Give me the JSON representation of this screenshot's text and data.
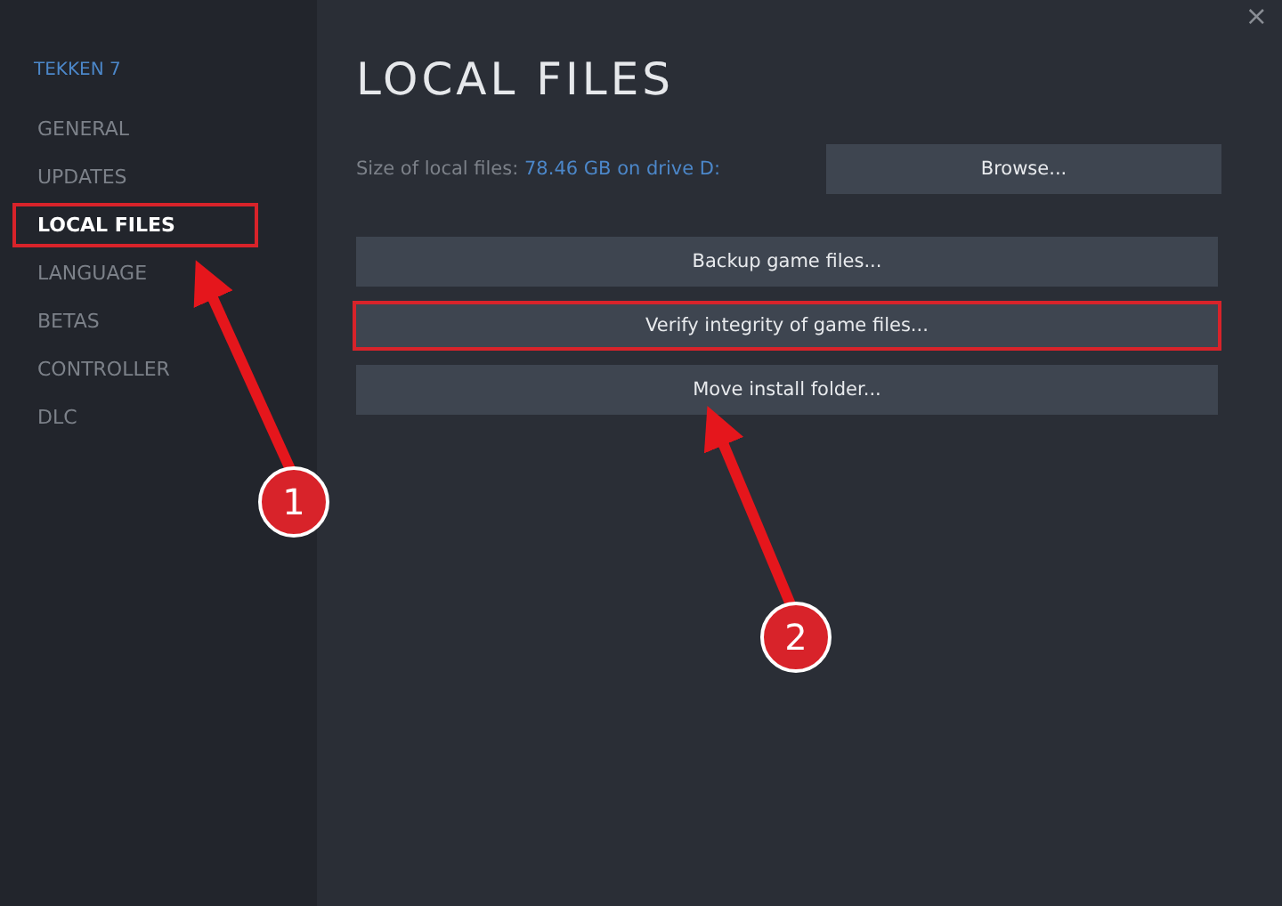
{
  "window": {
    "close": "×"
  },
  "sidebar": {
    "game": "TEKKEN 7",
    "items": [
      {
        "label": "GENERAL",
        "selected": false
      },
      {
        "label": "UPDATES",
        "selected": false
      },
      {
        "label": "LOCAL FILES",
        "selected": true
      },
      {
        "label": "LANGUAGE",
        "selected": false
      },
      {
        "label": "BETAS",
        "selected": false
      },
      {
        "label": "CONTROLLER",
        "selected": false
      },
      {
        "label": "DLC",
        "selected": false
      }
    ]
  },
  "main": {
    "title": "LOCAL FILES",
    "size_label": "Size of local files:",
    "size_value": "78.46 GB on drive D:",
    "browse": "Browse...",
    "buttons": [
      {
        "label": "Backup game files...",
        "highlighted": false
      },
      {
        "label": "Verify integrity of game files...",
        "highlighted": true
      },
      {
        "label": "Move install folder...",
        "highlighted": false
      }
    ]
  },
  "annotations": [
    {
      "number": "1"
    },
    {
      "number": "2"
    }
  ]
}
